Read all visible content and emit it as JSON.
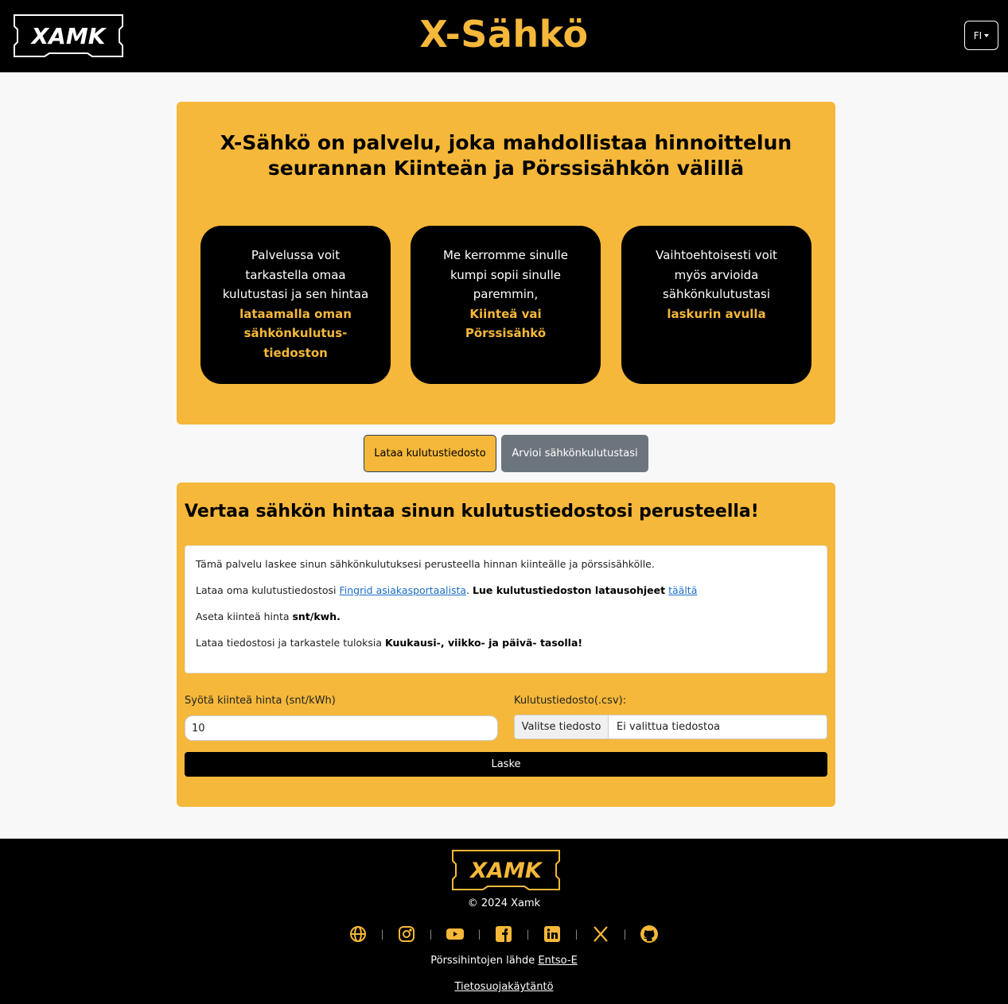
{
  "header": {
    "logo_text": "XAMK",
    "title": "X-Sähkö",
    "language": "FI"
  },
  "hero": {
    "title": "X-Sähkö on palvelu, joka mahdollistaa hinnoittelun seurannan Kiinteän ja Pörssisähkön välillä",
    "cards": [
      {
        "text": "Palvelussa voit tarkastella omaa kulutustasi ja sen hintaa",
        "highlight": "lataamalla oman sähkönkulutus-tiedoston"
      },
      {
        "text": "Me kerromme sinulle kumpi sopii sinulle paremmin,",
        "highlight": "Kiinteä vai Pörssisähkö"
      },
      {
        "text": "Vaihtoehtoisesti voit myös arvioida sähkönkulutustasi",
        "highlight": "laskurin avulla"
      }
    ]
  },
  "tabs": {
    "upload": "Lataa kulutustiedosto",
    "estimate": "Arvioi sähkönkulutustasi"
  },
  "calculator": {
    "title": "Vertaa sähkön hintaa sinun kulutustiedostosi perusteella!",
    "info": {
      "line1": "Tämä palvelu laskee sinun sähkönkulutuksesi perusteella hinnan kiinteälle ja pörssisähkölle.",
      "line2_pre": "Lataa oma kulutustiedostosi ",
      "line2_link": "Fingrid asiakasportaalista",
      "line2_mid": ". ",
      "line2_bold": "Lue kulutustiedoston latausohjeet",
      "line2_link2": "täältä",
      "line3_pre": "Aseta kiinteä hinta ",
      "line3_bold": "snt/kwh.",
      "line4_pre": "Lataa tiedostosi ja tarkastele tuloksia ",
      "line4_bold": "Kuukausi-, viikko- ja päivä- tasolla!"
    },
    "price_label": "Syötä kiinteä hinta (snt/kWh)",
    "price_value": "10",
    "file_label": "Kulutustiedosto(.csv):",
    "file_button": "Valitse tiedosto",
    "file_none": "Ei valittua tiedostoa",
    "submit": "Laske"
  },
  "footer": {
    "logo_text": "XAMK",
    "copyright": "© 2024 Xamk",
    "socials": [
      "globe-icon",
      "instagram-icon",
      "youtube-icon",
      "facebook-icon",
      "linkedin-icon",
      "x-icon",
      "github-icon"
    ],
    "source_pre": "Pörssihintojen lähde",
    "source_link": "Entso-E",
    "privacy": "Tietosuojakäytäntö"
  },
  "colors": {
    "accent": "#f5b83a",
    "dark": "#000000",
    "secondary": "#6c757d"
  }
}
